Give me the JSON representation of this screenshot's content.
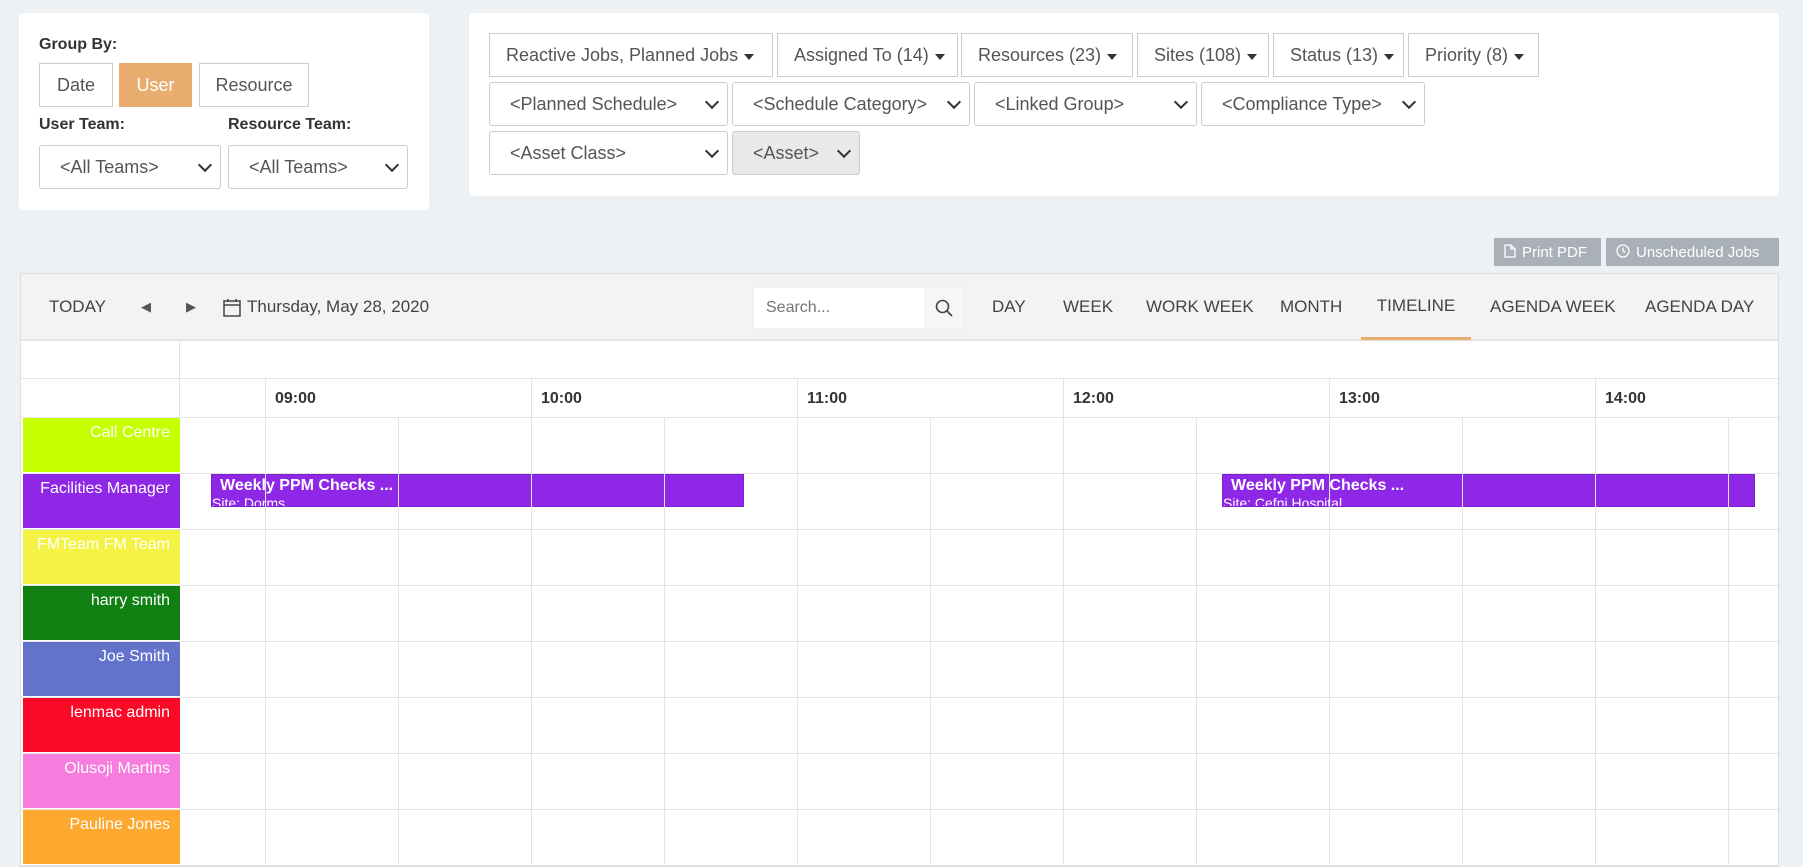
{
  "group_panel": {
    "group_by_label": "Group By:",
    "buttons": [
      {
        "label": "Date",
        "active": false
      },
      {
        "label": "User",
        "active": true
      },
      {
        "label": "Resource",
        "active": false
      }
    ],
    "user_team_label": "User Team:",
    "resource_team_label": "Resource Team:",
    "user_team_value": "<All Teams>",
    "resource_team_value": "<All Teams>"
  },
  "filters": {
    "buttons": [
      "Reactive Jobs, Planned Jobs",
      "Assigned To (14)",
      "Resources (23)",
      "Sites (108)",
      "Status (13)",
      "Priority (8)"
    ],
    "selects": [
      "<Planned Schedule>",
      "<Schedule Category>",
      "<Linked Group>",
      "<Compliance Type>",
      "<Asset Class>",
      "<Asset>"
    ]
  },
  "actions": {
    "print_pdf": "Print PDF",
    "unscheduled_jobs": "Unscheduled Jobs"
  },
  "toolbar": {
    "today": "TODAY",
    "date": "Thursday, May 28, 2020",
    "search_placeholder": "Search...",
    "views": [
      "DAY",
      "WEEK",
      "WORK WEEK",
      "MONTH",
      "TIMELINE",
      "AGENDA WEEK",
      "AGENDA DAY"
    ],
    "active_view": "TIMELINE"
  },
  "timeline": {
    "hours": [
      "09:00",
      "10:00",
      "11:00",
      "12:00",
      "13:00",
      "14:00"
    ],
    "rows": [
      {
        "label": "Call Centre",
        "color": "#c6ff00"
      },
      {
        "label": "Facilities Manager",
        "color": "#8f27e6"
      },
      {
        "label": "FMTeam FM Team",
        "color": "#f4f244"
      },
      {
        "label": "harry smith",
        "color": "#118012"
      },
      {
        "label": "Joe Smith",
        "color": "#6373cc"
      },
      {
        "label": "lenmac admin",
        "color": "#fb0a28"
      },
      {
        "label": "Olusoji Martins",
        "color": "#f67cdd"
      },
      {
        "label": "Pauline Jones",
        "color": "#fea82f"
      }
    ],
    "events": [
      {
        "title": "Weekly PPM Checks ...",
        "site": "Site: Dorms",
        "row": 1
      },
      {
        "title": "Weekly PPM Checks ...",
        "site": "Site: Cefni Hospital",
        "row": 1
      }
    ]
  }
}
